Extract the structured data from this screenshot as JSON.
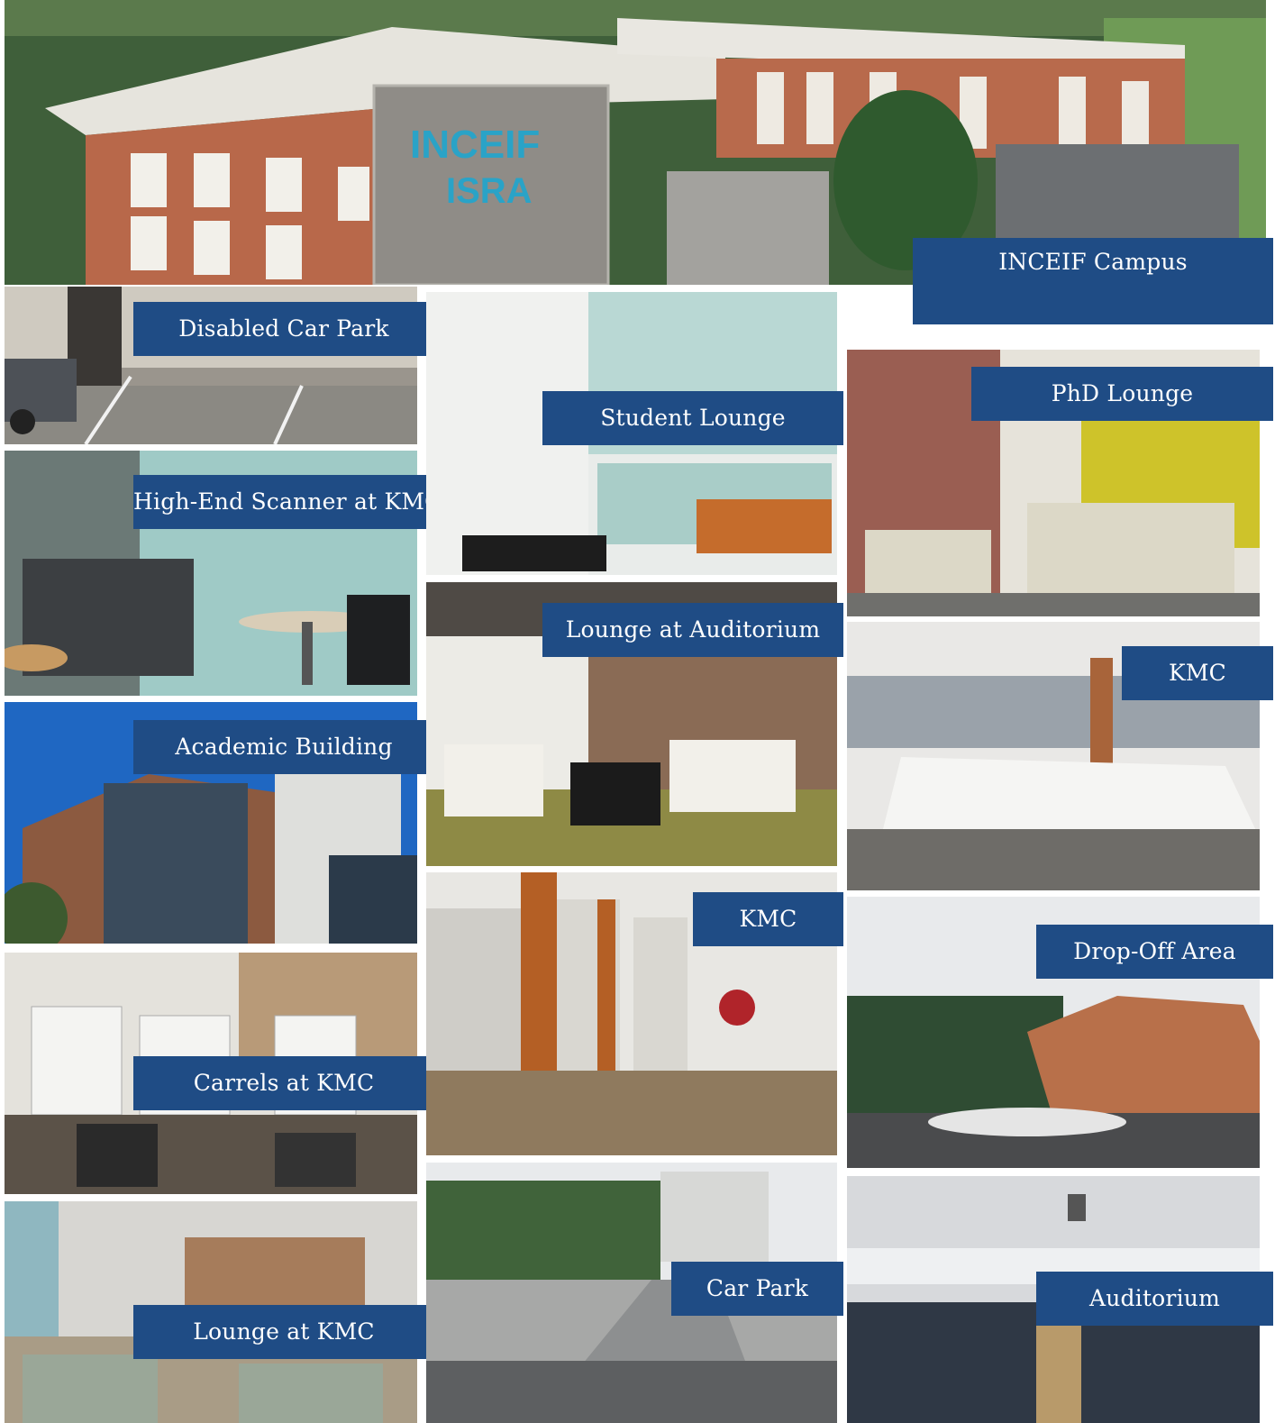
{
  "labels": {
    "inceif_campus": "INCEIF Campus",
    "disabled_car_park": "Disabled Car Park",
    "student_lounge": "Student Lounge",
    "phd_lounge": "PhD Lounge",
    "high_end_scanner": "High-End Scanner at KMC",
    "lounge_auditorium": "Lounge at Auditorium",
    "kmc_right": "KMC",
    "academic_building": "Academic Building",
    "kmc_middle": "KMC",
    "drop_off_area": "Drop-Off Area",
    "carrels_kmc": "Carrels at KMC",
    "lounge_kmc": "Lounge at KMC",
    "car_park": "Car Park",
    "auditorium": "Auditorium"
  },
  "building_sign": {
    "line1": "INCEIF",
    "line2": "ISRA"
  },
  "colors": {
    "label_background": "#1f4c85",
    "label_text": "#ffffff"
  }
}
